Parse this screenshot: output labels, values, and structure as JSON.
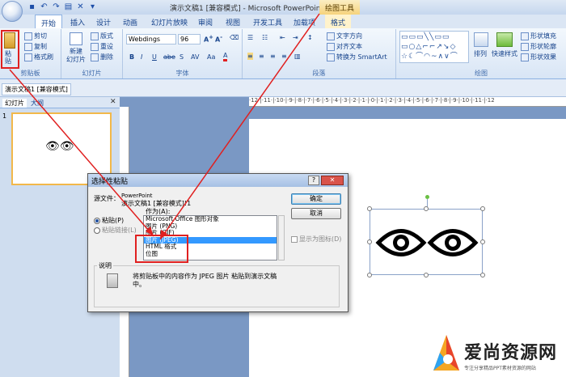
{
  "titlebar": {
    "title": "演示文稿1 [兼容模式] - Microsoft PowerPoint",
    "context": "绘图工具"
  },
  "tabs": [
    "开始",
    "插入",
    "设计",
    "动画",
    "幻灯片放映",
    "审阅",
    "视图",
    "开发工具",
    "加载项",
    "格式"
  ],
  "ribbon": {
    "clipboard": {
      "paste": "粘贴",
      "cut": "剪切",
      "copy": "复制",
      "format_painter": "格式刷",
      "label": "剪贴板"
    },
    "slides": {
      "new_slide": "新建\n幻灯片",
      "layout": "版式",
      "reset": "重设",
      "delete": "删除",
      "label": "幻灯片"
    },
    "font": {
      "font_name": "Webdings",
      "font_size": "96",
      "label": "字体"
    },
    "paragraph": {
      "text_direction": "文字方向",
      "align_text": "对齐文本",
      "smartart": "转换为 SmartArt",
      "label": "段落"
    },
    "drawing": {
      "arrange": "排列",
      "quick_styles": "快速样式",
      "shape_fill": "形状填充",
      "shape_outline": "形状轮廓",
      "shape_effects": "形状效果",
      "label": "绘图"
    }
  },
  "doc_tab": "演示文稿1 [兼容模式]",
  "left_tabs": {
    "slides": "幻灯片",
    "outline": "大纲"
  },
  "thumb_eyes": "👁👁",
  "dialog": {
    "title": "选择性粘贴",
    "source_label": "源文件：",
    "source_value1": "PowerPoint",
    "source_value2": "演示文稿1 [兼容模式]!1",
    "as_label": "作为(A):",
    "paste_option": "粘贴(P)",
    "paste_link_option": "粘贴链接(L)",
    "list": [
      "Microsoft Office 图形对象",
      "图片 (PNG)",
      "图片 (GIF)",
      "图片 (JPEG)",
      "HTML 格式",
      "位图"
    ],
    "ok": "确定",
    "cancel": "取消",
    "display_icon": "显示为图标(D)",
    "result_label": "说明",
    "result_text1": "将剪贴板中的内容作为 JPEG 图片 粘贴到演示文稿",
    "result_text2": "中。"
  },
  "watermark": {
    "title": "爱尚资源网",
    "sub": "专注分享精品PPT素材资源的网站"
  },
  "colors": {
    "accent": "#e02020",
    "selection": "#3399ff"
  }
}
